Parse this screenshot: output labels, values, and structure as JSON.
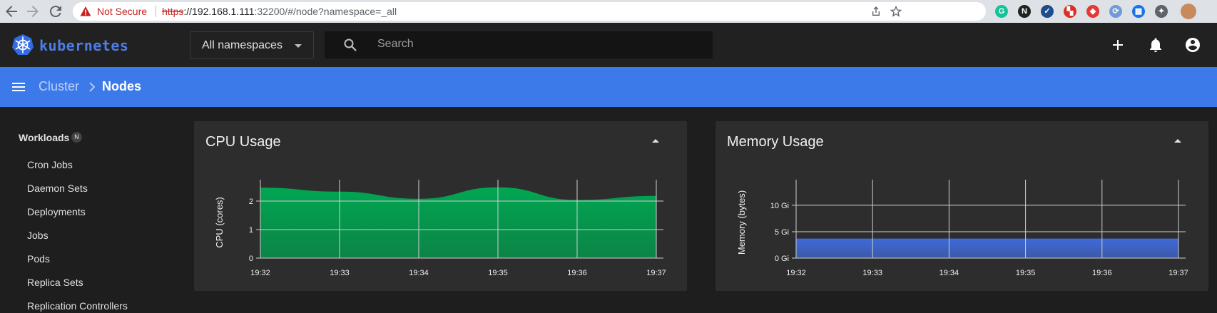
{
  "browser": {
    "back_icon": "arrow-left-icon",
    "forward_icon": "arrow-right-icon",
    "reload_icon": "reload-icon",
    "security_label": "Not Secure",
    "url_scheme": "https",
    "url_host": "://192.168.1.111",
    "url_rest": ":32200/#/node?namespace=_all",
    "share_icon": "share-icon",
    "bookmark_icon": "star-icon",
    "extensions": [
      {
        "name": "grammarly-extension-icon",
        "glyph": "G",
        "color": "#15c39a"
      },
      {
        "name": "notion-extension-icon",
        "glyph": "N",
        "color": "#222222"
      },
      {
        "name": "check-extension-icon",
        "glyph": "✓",
        "color": "#1e4d8c"
      },
      {
        "name": "map-extension-icon",
        "glyph": "▚",
        "color": "#d93025"
      },
      {
        "name": "shield-extension-icon",
        "glyph": "◆",
        "color": "#e53935"
      },
      {
        "name": "sync-extension-icon",
        "glyph": "⟳",
        "color": "#6f9bd8"
      },
      {
        "name": "grid-extension-icon",
        "glyph": "▦",
        "color": "#1a73e8"
      },
      {
        "name": "puzzle-extension-icon",
        "glyph": "✦",
        "color": "#5f6368"
      }
    ]
  },
  "header": {
    "logo_text": "kubernetes",
    "namespace_selected": "All namespaces",
    "search_placeholder": "Search",
    "accent": "#3d7ae9"
  },
  "breadcrumb": {
    "parent": "Cluster",
    "current": "Nodes"
  },
  "sidebar": {
    "heading": "Workloads",
    "heading_badge": "N",
    "items": [
      "Cron Jobs",
      "Daemon Sets",
      "Deployments",
      "Jobs",
      "Pods",
      "Replica Sets",
      "Replication Controllers"
    ]
  },
  "cpu_card": {
    "title": "CPU Usage"
  },
  "memory_card": {
    "title": "Memory Usage"
  },
  "chart_data": [
    {
      "type": "area",
      "title": "CPU Usage",
      "ylabel": "CPU (cores)",
      "xlabel": "",
      "x": [
        "19:32",
        "19:33",
        "19:34",
        "19:35",
        "19:36",
        "19:37"
      ],
      "x_ticks": [
        "19:32",
        "19:33",
        "19:34",
        "19:35",
        "19:36",
        "19:37"
      ],
      "y_ticks": [
        "0",
        "1",
        "2"
      ],
      "ylim": [
        0,
        2.5
      ],
      "series": [
        {
          "values": [
            2.47,
            2.33,
            2.08,
            2.48,
            2.04,
            2.18
          ],
          "color": "#00a651"
        }
      ],
      "grid": true
    },
    {
      "type": "area",
      "title": "Memory Usage",
      "ylabel": "Memory (bytes)",
      "xlabel": "",
      "x": [
        "19:32",
        "19:33",
        "19:34",
        "19:35",
        "19:36",
        "19:37"
      ],
      "x_ticks": [
        "19:32",
        "19:33",
        "19:34",
        "19:35",
        "19:36",
        "19:37"
      ],
      "y_ticks": [
        "0 Gi",
        "5 Gi",
        "10 Gi"
      ],
      "y_tick_values": [
        0,
        5,
        10
      ],
      "ylim": [
        0,
        13.5
      ],
      "series": [
        {
          "values": [
            3.7,
            3.7,
            3.7,
            3.7,
            3.7,
            3.7
          ],
          "color": "#3f6ad8"
        }
      ],
      "grid": true
    }
  ]
}
